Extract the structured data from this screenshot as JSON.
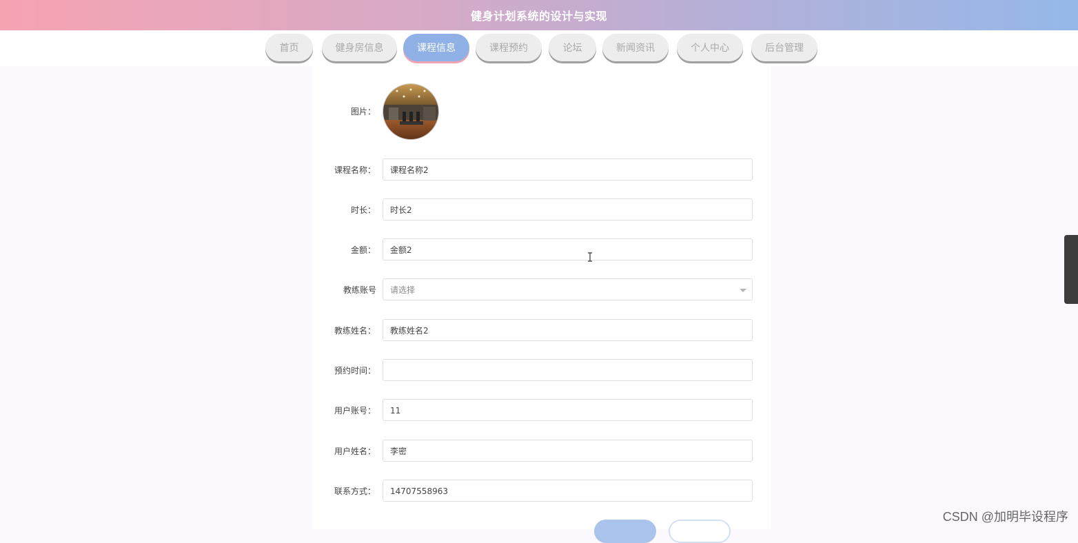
{
  "header": {
    "title": "健身计划系统的设计与实现"
  },
  "nav": {
    "items": [
      {
        "label": "首页"
      },
      {
        "label": "健身房信息"
      },
      {
        "label": "课程信息"
      },
      {
        "label": "课程预约"
      },
      {
        "label": "论坛"
      },
      {
        "label": "新闻资讯"
      },
      {
        "label": "个人中心"
      },
      {
        "label": "后台管理"
      }
    ],
    "active": "课程信息"
  },
  "form": {
    "image_label": "图片：",
    "fields": [
      {
        "label": "课程名称：",
        "value": "课程名称2"
      },
      {
        "label": "时长：",
        "value": "时长2"
      },
      {
        "label": "金额：",
        "value": "金额2"
      },
      {
        "label": "教练账号",
        "value": "",
        "placeholder": "请选择"
      },
      {
        "label": "教练姓名：",
        "value": "教练姓名2"
      },
      {
        "label": "预约时间：",
        "value": ""
      },
      {
        "label": "用户账号：",
        "value": "11"
      },
      {
        "label": "用户姓名：",
        "value": "李密"
      },
      {
        "label": "联系方式：",
        "value": "14707558963"
      }
    ]
  },
  "watermark": "CSDN @加明毕设程序",
  "colors": {
    "header_gradient_start": "#f6a3b1",
    "header_gradient_end": "#95b8e9",
    "nav_active": "#8fb1e6",
    "nav_inactive": "#ededed"
  }
}
